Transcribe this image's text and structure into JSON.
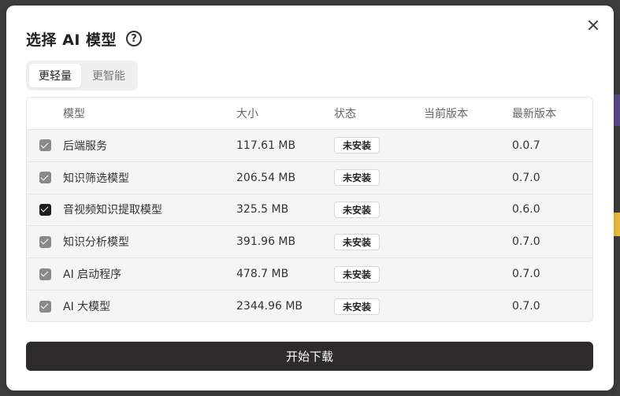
{
  "dialog": {
    "title": "选择 AI 模型",
    "help_icon": "question-circle-icon",
    "close_icon": "close-icon"
  },
  "tabs": [
    {
      "label": "更轻量",
      "active": true
    },
    {
      "label": "更智能",
      "active": false
    }
  ],
  "table": {
    "columns": [
      "模型",
      "大小",
      "状态",
      "当前版本",
      "最新版本"
    ],
    "rows": [
      {
        "checked": true,
        "name": "后端服务",
        "size": "117.61 MB",
        "status": "未安装",
        "current": "",
        "latest": "0.0.7"
      },
      {
        "checked": true,
        "name": "知识筛选模型",
        "size": "206.54 MB",
        "status": "未安装",
        "current": "",
        "latest": "0.7.0"
      },
      {
        "checked": true,
        "name": "音视频知识提取模型",
        "size": "325.5 MB",
        "status": "未安装",
        "current": "",
        "latest": "0.6.0"
      },
      {
        "checked": true,
        "name": "知识分析模型",
        "size": "391.96 MB",
        "status": "未安装",
        "current": "",
        "latest": "0.7.0"
      },
      {
        "checked": true,
        "name": "AI 启动程序",
        "size": "478.7 MB",
        "status": "未安装",
        "current": "",
        "latest": "0.7.0"
      },
      {
        "checked": true,
        "name": "AI 大模型",
        "size": "2344.96 MB",
        "status": "未安装",
        "current": "",
        "latest": "0.7.0"
      }
    ]
  },
  "actions": {
    "download_label": "开始下载"
  },
  "colors": {
    "primary_button": "#2d2c2a",
    "checkbox": "#8a8a88",
    "checkbox_focused": "#1e1e1e"
  }
}
